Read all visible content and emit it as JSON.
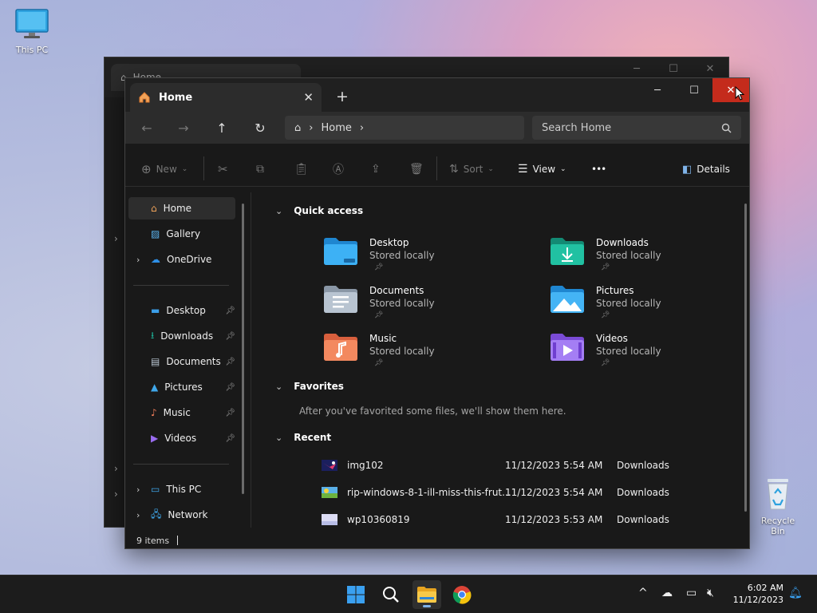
{
  "desktop": {
    "icons": [
      {
        "label": "This PC"
      },
      {
        "label": "Recycle Bin"
      }
    ]
  },
  "back_window": {
    "tab_title": "Home"
  },
  "window": {
    "tab_title": "Home",
    "address": {
      "location": "Home"
    },
    "search": {
      "placeholder": "Search Home"
    },
    "toolbar": {
      "new_label": "New",
      "sort_label": "Sort",
      "view_label": "View",
      "more_label": "•••",
      "details_label": "Details"
    },
    "sidebar": {
      "top": [
        {
          "label": "Home"
        },
        {
          "label": "Gallery"
        },
        {
          "label": "OneDrive"
        }
      ],
      "pinned": [
        {
          "label": "Desktop"
        },
        {
          "label": "Downloads"
        },
        {
          "label": "Documents"
        },
        {
          "label": "Pictures"
        },
        {
          "label": "Music"
        },
        {
          "label": "Videos"
        }
      ],
      "bottom": [
        {
          "label": "This PC"
        },
        {
          "label": "Network"
        }
      ]
    },
    "sections": {
      "quick_access": "Quick access",
      "favorites": "Favorites",
      "recent": "Recent"
    },
    "quick_access": [
      {
        "name": "Desktop",
        "status": "Stored locally"
      },
      {
        "name": "Downloads",
        "status": "Stored locally"
      },
      {
        "name": "Documents",
        "status": "Stored locally"
      },
      {
        "name": "Pictures",
        "status": "Stored locally"
      },
      {
        "name": "Music",
        "status": "Stored locally"
      },
      {
        "name": "Videos",
        "status": "Stored locally"
      }
    ],
    "favorites_message": "After you've favorited some files, we'll show them here.",
    "recent": [
      {
        "name": "img102",
        "date": "11/12/2023 5:54 AM",
        "location": "Downloads"
      },
      {
        "name": "rip-windows-8-1-ill-miss-this-frut...",
        "date": "11/12/2023 5:54 AM",
        "location": "Downloads"
      },
      {
        "name": "wp10360819",
        "date": "11/12/2023 5:53 AM",
        "location": "Downloads"
      }
    ],
    "status": {
      "items": "9 items"
    }
  },
  "taskbar": {
    "time": "6:02 AM",
    "date": "11/12/2023"
  },
  "colors": {
    "close_red": "#c42b1c",
    "folder_blue": "#3b9ee8",
    "folder_teal": "#1fb59a",
    "accent": "#7fb3e8"
  }
}
